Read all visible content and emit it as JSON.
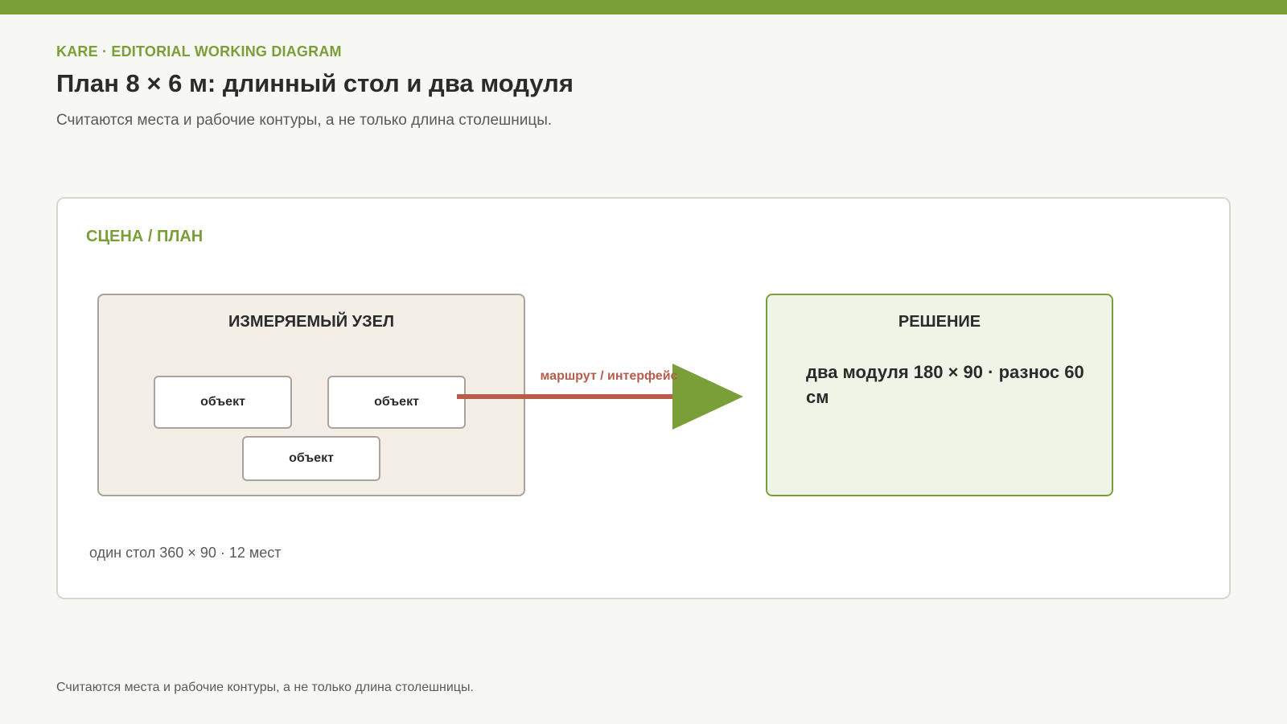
{
  "header": {
    "kicker": "KARE · EDITORIAL WORKING DIAGRAM",
    "title": "План 8 × 6 м: длинный стол и два модуля",
    "subtitle": "Считаются места и рабочие контуры, а не только длина столешницы."
  },
  "diagram": {
    "section_label": "СЦЕНА / ПЛАН",
    "measured_node": {
      "title": "ИЗМЕРЯЕМЫЙ УЗЕЛ",
      "objects": [
        "объект",
        "объект",
        "объект"
      ]
    },
    "connector_label": "маршрут / интерфейс",
    "solution": {
      "title": "РЕШЕНИЕ",
      "text": "два модуля 180 × 90 · разнос 60 см"
    },
    "note": "один стол 360 × 90 · 12 мест"
  },
  "footer": {
    "note": "Считаются места и рабочие контуры, а не только длина столешницы."
  },
  "colors": {
    "accent": "#7a9e38",
    "connector": "#b85c4c",
    "node_fill": "#f3eee6",
    "solution_fill": "#eef4e6"
  }
}
